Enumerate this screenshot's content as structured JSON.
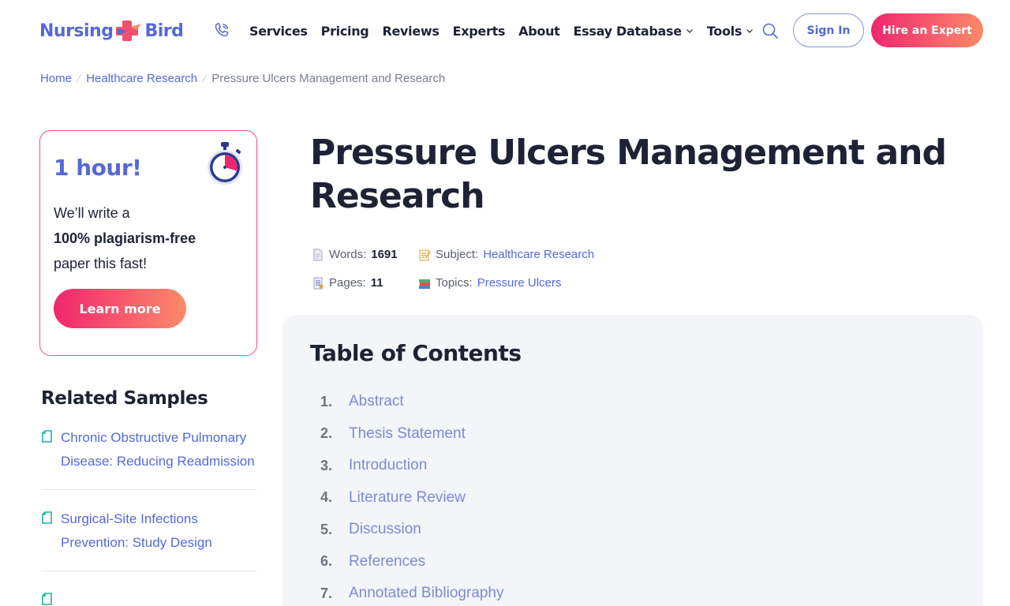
{
  "header": {
    "logo": {
      "left": "Nursing",
      "right": "Bird"
    },
    "nav": [
      {
        "label": "Services",
        "dropdown": false
      },
      {
        "label": "Pricing",
        "dropdown": false
      },
      {
        "label": "Reviews",
        "dropdown": false
      },
      {
        "label": "Experts",
        "dropdown": false
      },
      {
        "label": "About",
        "dropdown": false
      },
      {
        "label": "Essay Database",
        "dropdown": true
      },
      {
        "label": "Tools",
        "dropdown": true
      }
    ],
    "signin_label": "Sign In",
    "hire_label": "Hire an Expert"
  },
  "breadcrumb": {
    "items": [
      "Home",
      "Healthcare Research"
    ],
    "current": "Pressure Ulcers Management and Research"
  },
  "promo": {
    "title": "1 hour!",
    "line1": "We’ll write a",
    "line2": "100% plagiarism-free",
    "line3": "paper this fast!",
    "button": "Learn more"
  },
  "related": {
    "title": "Related Samples",
    "items": [
      "Chronic Obstructive Pulmonary Disease: Reducing Readmission",
      "Surgical-Site Infections Prevention: Study Design"
    ]
  },
  "article": {
    "title": "Pressure Ulcers Management and Research",
    "meta": {
      "words_label": "Words:",
      "words": "1691",
      "subject_label": "Subject:",
      "subject": "Healthcare Research",
      "pages_label": "Pages:",
      "pages": "11",
      "topics_label": "Topics:",
      "topics": "Pressure Ulcers"
    }
  },
  "toc": {
    "title": "Table of Contents",
    "items": [
      {
        "num": "1.",
        "label": "Abstract"
      },
      {
        "num": "2.",
        "label": "Thesis Statement"
      },
      {
        "num": "3.",
        "label": "Introduction"
      },
      {
        "num": "4.",
        "label": "Literature Review"
      },
      {
        "num": "5.",
        "label": "Discussion"
      },
      {
        "num": "6.",
        "label": "References"
      },
      {
        "num": "7.",
        "label": "Annotated Bibliography"
      }
    ]
  },
  "colors": {
    "brand": "#5569d6",
    "accent_start": "#f0266f",
    "accent_end": "#fc8a6a",
    "toc_bg": "#f4f5f9"
  },
  "icons": [
    "phone-icon",
    "search-icon",
    "chevron-down-icon",
    "stopwatch-icon",
    "document-icon",
    "memo-icon",
    "pages-icon",
    "books-icon"
  ]
}
